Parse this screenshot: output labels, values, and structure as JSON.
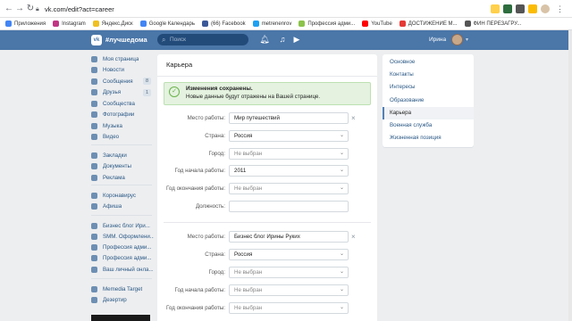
{
  "browser": {
    "url": "vk.com/edit?act=career",
    "bookmarks": [
      {
        "label": "Приложения",
        "color": "#4285f4"
      },
      {
        "label": "Instagram",
        "color": "#c13584"
      },
      {
        "label": "Яндекс.Диск",
        "color": "#f0c020"
      },
      {
        "label": "Google Календарь",
        "color": "#4285f4"
      },
      {
        "label": "(66) Facebook",
        "color": "#3b5998"
      },
      {
        "label": "metrenenrov",
        "color": "#1da1f2"
      },
      {
        "label": "Профессия адми...",
        "color": "#8bc34a"
      },
      {
        "label": "YouTube",
        "color": "#ff0000"
      },
      {
        "label": "ДОСТИЖЕНИЕ М...",
        "color": "#e53935"
      },
      {
        "label": "ФИН ПЕРЕЗАГРУ...",
        "color": "#555555"
      }
    ]
  },
  "header": {
    "brand": "#лучшедома",
    "search_placeholder": "Поиск",
    "user_name": "Ирина"
  },
  "left_menu": {
    "main": [
      {
        "label": "Моя страница",
        "count": ""
      },
      {
        "label": "Новости",
        "count": ""
      },
      {
        "label": "Сообщения",
        "count": "8"
      },
      {
        "label": "Друзья",
        "count": "1"
      },
      {
        "label": "Сообщества",
        "count": ""
      },
      {
        "label": "Фотографии",
        "count": ""
      },
      {
        "label": "Музыка",
        "count": ""
      },
      {
        "label": "Видео",
        "count": ""
      }
    ],
    "second": [
      {
        "label": "Закладки"
      },
      {
        "label": "Документы"
      },
      {
        "label": "Реклама"
      }
    ],
    "third": [
      {
        "label": "Коронавирус"
      },
      {
        "label": "Афиша"
      }
    ],
    "groups": [
      {
        "label": "Бизнес блог Ири..."
      },
      {
        "label": "SMM. Оформлени..."
      },
      {
        "label": "Профессия адми..."
      },
      {
        "label": "Профессия адми..."
      },
      {
        "label": "Ваш личный онла..."
      }
    ],
    "apps": [
      {
        "label": "Memedia Target"
      },
      {
        "label": "Дезертир"
      }
    ]
  },
  "main": {
    "title": "Карьера",
    "notice_title": "Изменения сохранены.",
    "notice_text": "Новые данные будут отражены на Вашей странице.",
    "block1": {
      "workplace_label": "Место работы:",
      "workplace_value": "Мир путешествий",
      "country_label": "Страна:",
      "country_value": "Россия",
      "city_label": "Город:",
      "city_value": "Не выбран",
      "start_label": "Год начала работы:",
      "start_value": "2011",
      "end_label": "Год окончания работы:",
      "end_value": "Не выбран",
      "position_label": "Должность:",
      "position_value": ""
    },
    "block2": {
      "workplace_label": "Место работы:",
      "workplace_value": "Бизнес блог Ирины Руких",
      "country_label": "Страна:",
      "country_value": "Россия",
      "city_label": "Город:",
      "city_value": "Не выбран",
      "start_label": "Год начала работы:",
      "start_value": "Не выбран",
      "end_label": "Год окончания работы:",
      "end_value": "Не выбран"
    }
  },
  "right_menu": {
    "items": [
      {
        "label": "Основное"
      },
      {
        "label": "Контакты"
      },
      {
        "label": "Интересы"
      },
      {
        "label": "Образование"
      },
      {
        "label": "Карьера"
      },
      {
        "label": "Военная служба"
      },
      {
        "label": "Жизненная позиция"
      }
    ],
    "active_index": 4
  }
}
